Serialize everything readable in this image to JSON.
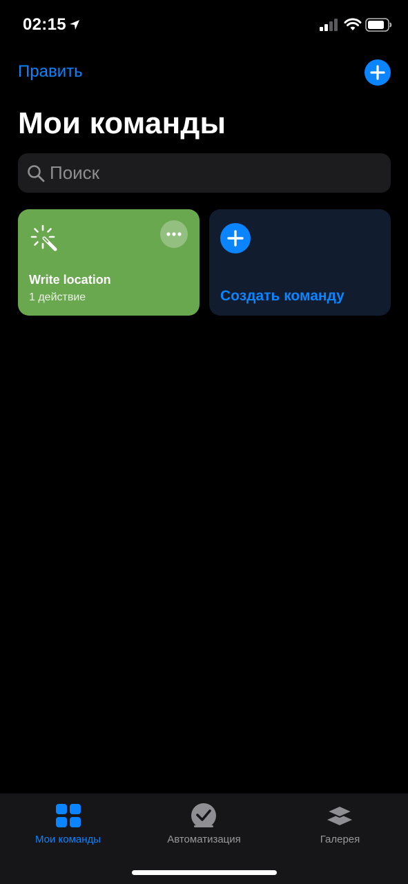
{
  "status_bar": {
    "time": "02:15",
    "icons": [
      "location-arrow-icon",
      "cellular-signal-icon",
      "wifi-icon",
      "battery-icon"
    ]
  },
  "nav": {
    "edit_label": "Править",
    "add_icon": "plus-icon"
  },
  "page_title": "Мои команды",
  "search": {
    "placeholder": "Поиск",
    "value": "",
    "icon": "search-icon"
  },
  "shortcuts": [
    {
      "title": "Write location",
      "subtitle": "1 действие",
      "icon": "magic-wand-icon",
      "color": "#6aa84f"
    }
  ],
  "create_card": {
    "label": "Создать команду",
    "icon": "plus-icon",
    "color": "#111c2e"
  },
  "tab_bar": {
    "tabs": [
      {
        "label": "Мои команды",
        "icon": "grid-icon",
        "active": true
      },
      {
        "label": "Автоматизация",
        "icon": "clock-check-icon",
        "active": false
      },
      {
        "label": "Галерея",
        "icon": "layers-icon",
        "active": false
      }
    ]
  },
  "colors": {
    "accent": "#0a84ff",
    "background": "#000000",
    "search_bg": "#1c1c1e",
    "inactive_tab": "#98989d"
  }
}
